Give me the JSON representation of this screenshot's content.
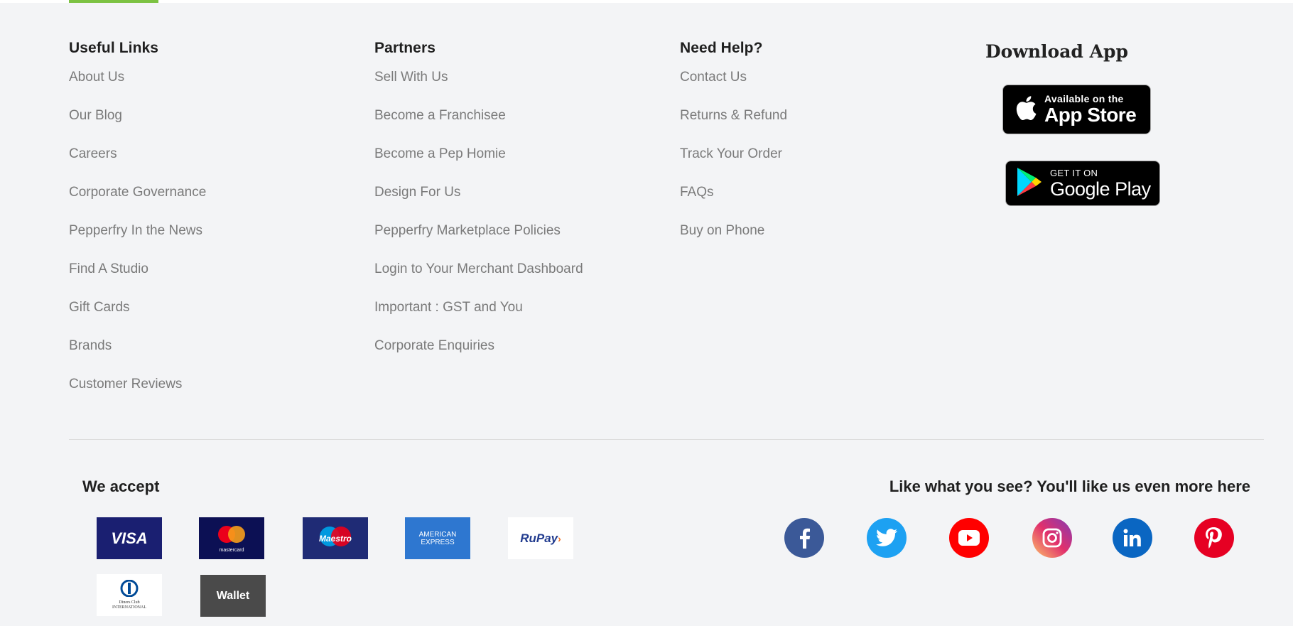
{
  "footer": {
    "useful_links": {
      "title": "Useful Links",
      "items": [
        "About Us",
        "Our Blog",
        "Careers",
        "Corporate Governance",
        "Pepperfry In the News",
        "Find A Studio",
        "Gift Cards",
        "Brands",
        "Customer Reviews"
      ]
    },
    "partners": {
      "title": "Partners",
      "items": [
        "Sell With Us",
        "Become a Franchisee",
        "Become a Pep Homie",
        "Design For Us",
        "Pepperfry Marketplace Policies",
        "Login to Your Merchant Dashboard",
        "Important : GST and You",
        "Corporate Enquiries"
      ]
    },
    "need_help": {
      "title": "Need Help?",
      "items": [
        "Contact Us",
        "Returns & Refund",
        "Track Your Order",
        "FAQs",
        "Buy on Phone"
      ]
    },
    "download_app": {
      "title": "Download App",
      "app_store": {
        "small": "Available on the",
        "big": "App Store"
      },
      "google_play": {
        "small": "GET IT ON",
        "big": "Google Play"
      }
    },
    "payments": {
      "title": "We accept",
      "cards": [
        {
          "name": "visa",
          "label": "VISA"
        },
        {
          "name": "mastercard",
          "label": "mastercard"
        },
        {
          "name": "maestro",
          "label": "Maestro"
        },
        {
          "name": "american-express",
          "label": "AMERICAN EXPRESS"
        },
        {
          "name": "rupay",
          "label": "RuPay"
        },
        {
          "name": "diners-club",
          "label": "Diners Club INTERNATIONAL"
        },
        {
          "name": "wallet",
          "label": "Wallet"
        }
      ]
    },
    "social": {
      "title": "Like what you see? You'll like us even more here",
      "icons": [
        "facebook-icon",
        "twitter-icon",
        "youtube-icon",
        "instagram-icon",
        "linkedin-icon",
        "pinterest-icon"
      ]
    },
    "colors": {
      "accent": "#7cc242",
      "background": "#f3f4f6",
      "link": "#7a7a7a",
      "facebook": "#3b5998",
      "twitter": "#1da1f2",
      "youtube": "#ff0000",
      "linkedin": "#0a66c2",
      "pinterest": "#e60023"
    }
  }
}
